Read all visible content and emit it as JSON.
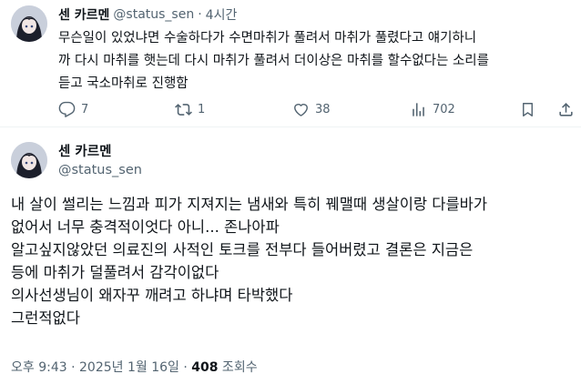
{
  "reply_tweet": {
    "author_name": "센 카르멘",
    "author_handle": "@status_sen",
    "separator": "·",
    "time": "4시간",
    "body_lines": [
      "무슨일이 있었냐면 수술하다가 수면마취가 풀려서 마취가 풀렸다고 얘기하니",
      "까 다시 마취를 햇는데 다시 마취가 풀려서 더이상은 마취를 할수없다는 소리를",
      "듣고 국소마취로 진행함"
    ],
    "stats": {
      "replies": "7",
      "reposts": "1",
      "likes": "38",
      "views": "702"
    }
  },
  "main_tweet": {
    "author_name": "센 카르멘",
    "author_handle": "@status_sen",
    "body_lines": [
      "내 살이 썰리는 느낌과 피가 지져지는 냄새와 특히 꿰맬때 생살이랑 다를바가",
      "없어서 너무 충격적이엇다 아니... 존나아파",
      "알고싶지않았던 의료진의 사적인 토크를 전부다 들어버렸고 결론은 지금은",
      "등에 마취가 덜풀려서 감각이없다",
      "의사선생님이 왜자꾸 깨려고 하냐며 타박했다",
      "그런적없다"
    ],
    "timestamp": "오후 9:43 · 2025년 1월 16일 · ",
    "views_count": "408",
    "views_label": " 조회수"
  },
  "icons": {
    "avatar": "avatar-icon",
    "reply": "reply-icon",
    "repost": "repost-icon",
    "like": "heart-icon",
    "views": "views-chart-icon",
    "bookmark": "bookmark-icon",
    "share": "share-icon"
  },
  "colors": {
    "text_primary": "#0f1419",
    "text_secondary": "#536471",
    "divider": "#eff3f4"
  }
}
